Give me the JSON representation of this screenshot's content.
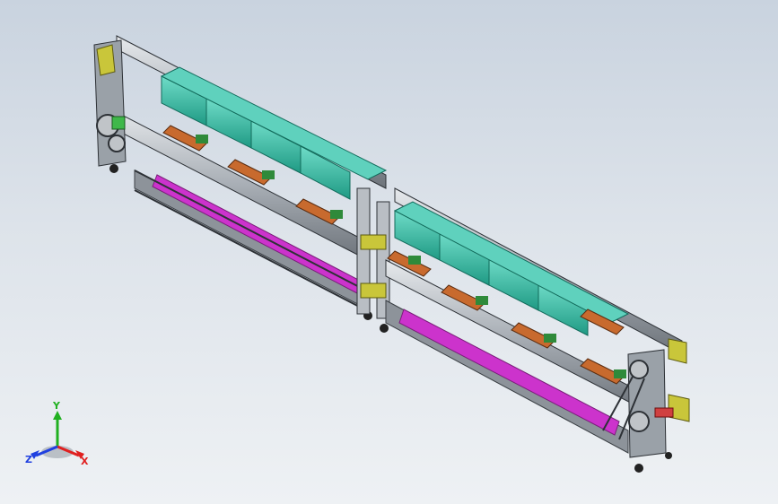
{
  "view": {
    "background_top": "#c9d3df",
    "background_bottom": "#eef1f4"
  },
  "model": {
    "frame_color": "#b9bec4",
    "frame_dark": "#4a4f55",
    "cover_color": "#2fb59d",
    "cover_light": "#5fd1bd",
    "carrier_color": "#c86a2e",
    "pallet_color": "#2f8a3a",
    "conveyor_color": "#cc33cc",
    "bracket_color": "#c9c63a",
    "motor_color": "#d04040"
  },
  "triad": {
    "x_label": "X",
    "y_label": "Y",
    "z_label": "Z",
    "x_color": "#e02020",
    "y_color": "#20b020",
    "z_color": "#2040e0"
  }
}
